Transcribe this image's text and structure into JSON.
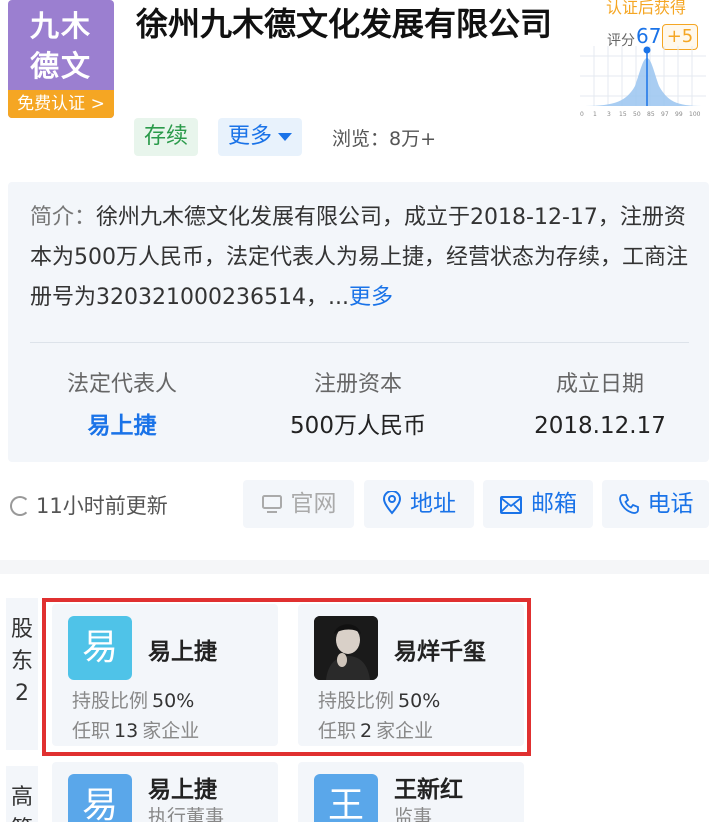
{
  "company": {
    "logo_text_line1": "九木",
    "logo_text_line2": "德文",
    "logo_badge": "免费认证 >",
    "name": "徐州九木德文化发展有限公司",
    "status_tag": "存续",
    "more_tag": "更多",
    "views": "浏览：8万+"
  },
  "score": {
    "top_text": "认证后获得",
    "label": "评分",
    "value": "67",
    "plus": "+5",
    "axis_ticks": [
      "0",
      "1",
      "3",
      "15",
      "50",
      "85",
      "97",
      "99",
      "100"
    ]
  },
  "intro": {
    "label": "简介：",
    "text": "徐州九木德文化发展有限公司，成立于2018-12-17，注册资本为500万人民币，法定代表人为易上捷，经营状态为存续，工商注册号为320321000236514，...",
    "more": "更多"
  },
  "info": {
    "legal_rep_label": "法定代表人",
    "legal_rep_value": "易上捷",
    "capital_label": "注册资本",
    "capital_value": "500万人民币",
    "founded_label": "成立日期",
    "founded_value": "2018.12.17"
  },
  "update": {
    "text": "11小时前更新"
  },
  "actions": {
    "website": "官网",
    "address": "地址",
    "email": "邮箱",
    "phone": "电话"
  },
  "shareholders": {
    "side_label": "股东",
    "count": "2",
    "items": [
      {
        "avatar": "易",
        "name": "易上捷",
        "ratio_label": "持股比例",
        "ratio": "50%",
        "job_prefix": "任职",
        "job_count": "13",
        "job_suffix": "家企业"
      },
      {
        "avatar": "",
        "name": "易烊千玺",
        "ratio_label": "持股比例",
        "ratio": "50%",
        "job_prefix": "任职",
        "job_count": "2",
        "job_suffix": "家企业"
      }
    ]
  },
  "executives": {
    "side_label": "高管",
    "items": [
      {
        "avatar": "易",
        "name": "易上捷",
        "role": "执行董事"
      },
      {
        "avatar": "王",
        "name": "王新红",
        "role": "监事"
      }
    ]
  },
  "colors": {
    "brand_blue": "#1a73e8",
    "status_green": "#2a9a4a",
    "badge_orange": "#f5a623",
    "highlight_red": "#e03030"
  }
}
